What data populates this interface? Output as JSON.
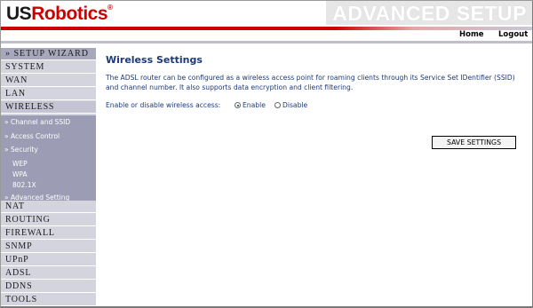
{
  "header": {
    "logo_us": "US",
    "logo_robotics": "Robotics",
    "logo_reg": "®",
    "banner": "ADVANCED SETUP"
  },
  "toplinks": {
    "home": "Home",
    "logout": "Logout"
  },
  "sidebar": {
    "wizard": "» SETUP WIZARD",
    "items": [
      "SYSTEM",
      "WAN",
      "LAN",
      "WIRELESS"
    ],
    "sub_items": [
      "» Channel and SSID",
      "» Access Control",
      "» Security",
      "WEP",
      "WPA",
      "802.1X",
      "» Advanced Setting"
    ],
    "items_after": [
      "NAT",
      "ROUTING",
      "FIREWALL",
      "SNMP",
      "UPnP",
      "ADSL",
      "DDNS",
      "TOOLS"
    ]
  },
  "main": {
    "title": "Wireless Settings",
    "description": "The ADSL router can be configured as a wireless access point for roaming clients through its Service Set IDentifier (SSID) and channel number. It also supports data encryption and client filtering.",
    "access_label": "Enable or disable wireless access:",
    "enable_label": "Enable",
    "disable_label": "Disable",
    "selected": "Enable",
    "save_label": "SAVE SETTINGS"
  }
}
